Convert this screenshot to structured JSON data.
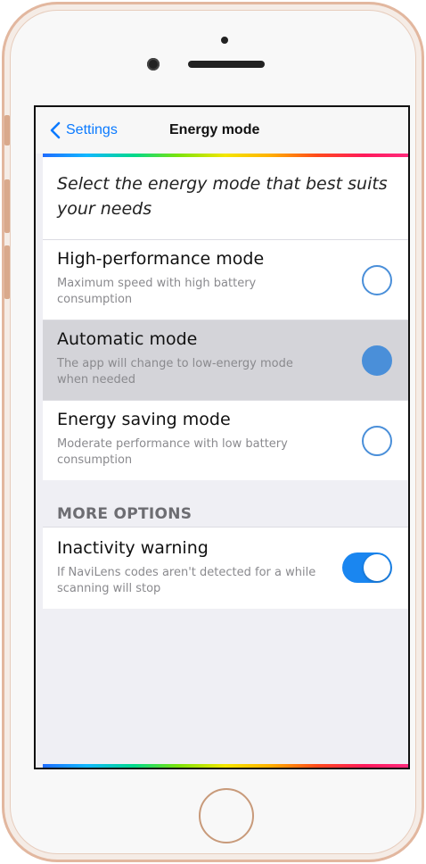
{
  "navbar": {
    "back_label": "Settings",
    "title": "Energy mode"
  },
  "intro": {
    "text": "Select the energy mode that best suits your needs"
  },
  "modes": [
    {
      "title": "High-performance mode",
      "description": "Maximum speed with high battery consumption",
      "selected": false
    },
    {
      "title": "Automatic mode",
      "description": "The app will change to low-energy mode when needed",
      "selected": true
    },
    {
      "title": "Energy saving mode",
      "description": "Moderate performance with low battery consumption",
      "selected": false
    }
  ],
  "more_options": {
    "header": "MORE OPTIONS",
    "inactivity": {
      "title": "Inactivity warning",
      "description": "If NaviLens codes aren't detected for a while scanning will stop",
      "enabled": true
    }
  },
  "colors": {
    "accent": "#0a7aff",
    "radio": "#4a8fd9",
    "toggle_on": "#1a86f0",
    "selected_row": "#d4d4d9",
    "phone_frame": "#e2b79f"
  },
  "icons": {
    "back": "chevron-left-icon"
  }
}
